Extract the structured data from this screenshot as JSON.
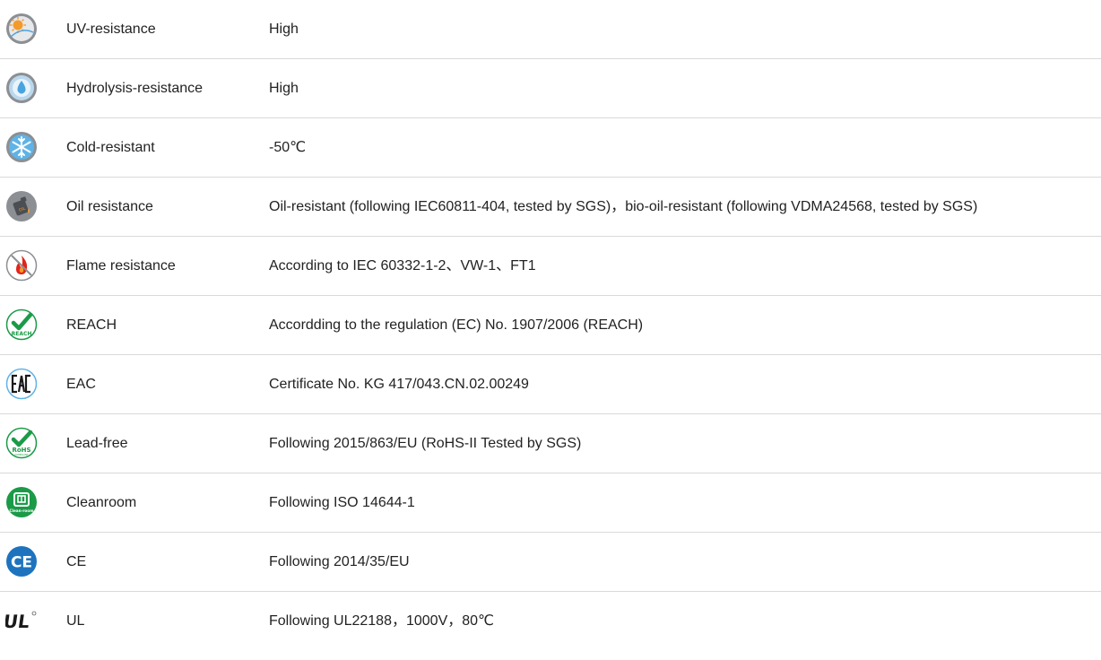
{
  "rows": [
    {
      "icon": "uv-sun-icon",
      "label": "UV-resistance",
      "value": "High"
    },
    {
      "icon": "water-drop-icon",
      "label": "Hydrolysis-resistance",
      "value": "High"
    },
    {
      "icon": "snowflake-icon",
      "label": "Cold-resistant",
      "value": "-50℃"
    },
    {
      "icon": "oil-can-icon",
      "label": "Oil resistance",
      "value": "Oil-resistant (following IEC60811-404, tested by SGS)，bio-oil-resistant (following VDMA24568, tested by SGS)"
    },
    {
      "icon": "no-flame-icon",
      "label": "Flame resistance",
      "value": "According to IEC 60332-1-2、VW-1、FT1"
    },
    {
      "icon": "reach-check-icon",
      "label": "REACH",
      "value": "Accordding to the regulation (EC) No. 1907/2006 (REACH)"
    },
    {
      "icon": "eac-mark-icon",
      "label": "EAC",
      "value": "Certificate No. KG 417/043.CN.02.00249"
    },
    {
      "icon": "rohs-check-icon",
      "label": "Lead-free",
      "value": "Following 2015/863/EU (RoHS-II Tested by SGS)"
    },
    {
      "icon": "cleanroom-icon",
      "label": "Cleanroom",
      "value": "Following ISO 14644-1"
    },
    {
      "icon": "ce-mark-icon",
      "label": "CE",
      "value": "Following 2014/35/EU"
    },
    {
      "icon": "ul-mark-icon",
      "label": "UL",
      "value": "Following UL22188，1000V，80℃"
    }
  ],
  "icon_text": {
    "uv": "UV",
    "oil": "OIL",
    "reach": "REACH",
    "eac": "EAC",
    "rohs": "RoHS",
    "rohs_sub": "COMPLIANT",
    "cleanroom": "Clean-room",
    "ce": "CE",
    "ul": "UL"
  },
  "colors": {
    "divider": "#d9d9d9",
    "icon_grey": "#8c8f93",
    "orange": "#f39a2b",
    "water_blue": "#4aa3df",
    "flame_red": "#e2231a",
    "green": "#1b9a48",
    "ce_blue": "#1e73be"
  }
}
